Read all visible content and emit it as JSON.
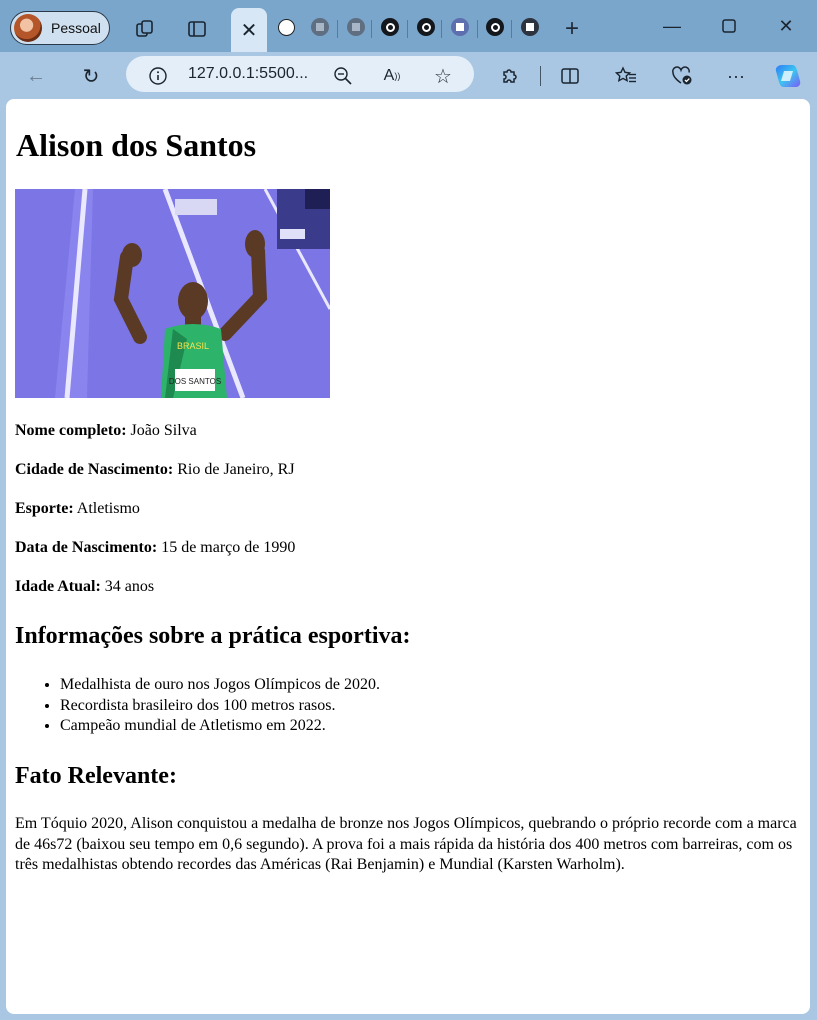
{
  "browser": {
    "profile_label": "Pessoal",
    "url": "127.0.0.1:5500...",
    "icons": {
      "workspaces": "workspaces-icon",
      "tab_actions": "tab-actions-icon",
      "back": "back-arrow-icon",
      "refresh": "refresh-icon",
      "info": "info-icon",
      "zoom": "zoom-out-icon",
      "read_aloud": "read-aloud-icon",
      "favorite": "star-icon",
      "extensions": "puzzle-icon",
      "split": "split-screen-icon",
      "favorites": "favorites-icon",
      "health": "browser-essentials-icon",
      "more": "more-icon",
      "copilot": "copilot-icon"
    },
    "accent_color": "#7aa6cc"
  },
  "page": {
    "title": "Alison dos Santos",
    "details": [
      {
        "label": "Nome completo:",
        "value": "João Silva"
      },
      {
        "label": "Cidade de Nascimento:",
        "value": "Rio de Janeiro, RJ"
      },
      {
        "label": "Esporte:",
        "value": "Atletismo"
      },
      {
        "label": "Data de Nascimento:",
        "value": "15 de março de 1990"
      },
      {
        "label": "Idade Atual:",
        "value": "34 anos"
      }
    ],
    "sports_heading": "Informações sobre a prática esportiva:",
    "sports_items": [
      "Medalhista de ouro nos Jogos Olímpicos de 2020.",
      "Recordista brasileiro dos 100 metros rasos.",
      "Campeão mundial de Atletismo em 2022."
    ],
    "fact_heading": "Fato Relevante:",
    "fact_text": "Em Tóquio 2020, Alison conquistou a medalha de bronze nos Jogos Olímpicos, quebrando o próprio recorde com a marca de 46s72 (baixou seu tempo em 0,6 segundo). A prova foi a mais rápida da história dos 400 metros com barreiras, com os três medalhistas obtendo recordes das Américas (Rai Benjamin) e Mundial (Karsten Warholm).",
    "photo": {
      "shirt_text": "BRASIL",
      "bib_text": "DOS SANTOS"
    }
  }
}
